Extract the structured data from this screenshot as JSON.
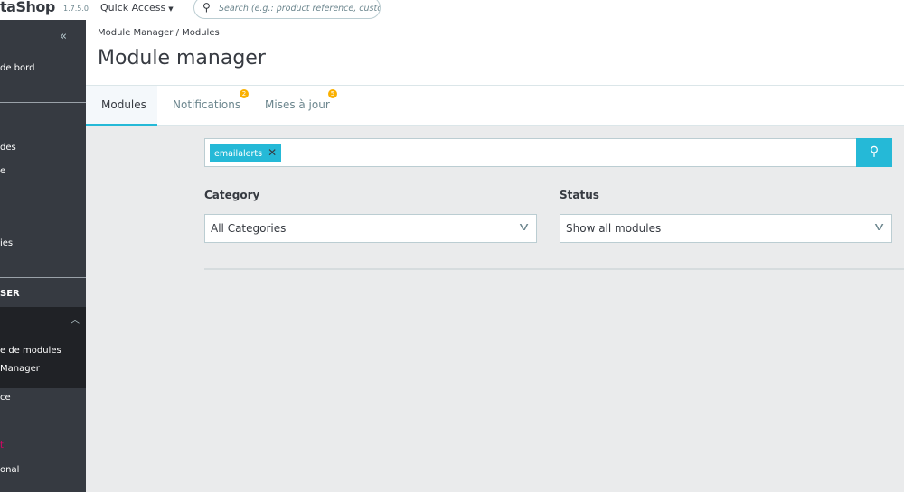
{
  "topbar": {
    "logo": "taShop",
    "version": "1.7.5.0",
    "quick_access": "Quick Access",
    "search_placeholder": "Search (e.g.: product reference, custome"
  },
  "sidebar": {
    "items": [
      {
        "label": "de bord"
      },
      {
        "label": "des"
      },
      {
        "label": "e"
      },
      {
        "label": "ies"
      },
      {
        "label": "SER"
      },
      {
        "label": "e de modules"
      },
      {
        "label": "Manager"
      },
      {
        "label": "ce"
      },
      {
        "label": "t"
      },
      {
        "label": "onal"
      }
    ]
  },
  "header": {
    "breadcrumb": [
      "Module Manager",
      "/",
      "Modules"
    ],
    "title": "Module manager"
  },
  "tabs": [
    {
      "label": "Modules",
      "active": true
    },
    {
      "label": "Notifications",
      "badge": "2"
    },
    {
      "label": "Mises à jour",
      "badge": "5"
    }
  ],
  "search": {
    "tag": "emailalerts"
  },
  "filters": {
    "category_label": "Category",
    "category_value": "All Categories",
    "status_label": "Status",
    "status_value": "Show all modules"
  },
  "colors": {
    "accent": "#25b9d7",
    "sidebar": "#363a41",
    "badge": "#fab000",
    "brand": "#df0067"
  }
}
